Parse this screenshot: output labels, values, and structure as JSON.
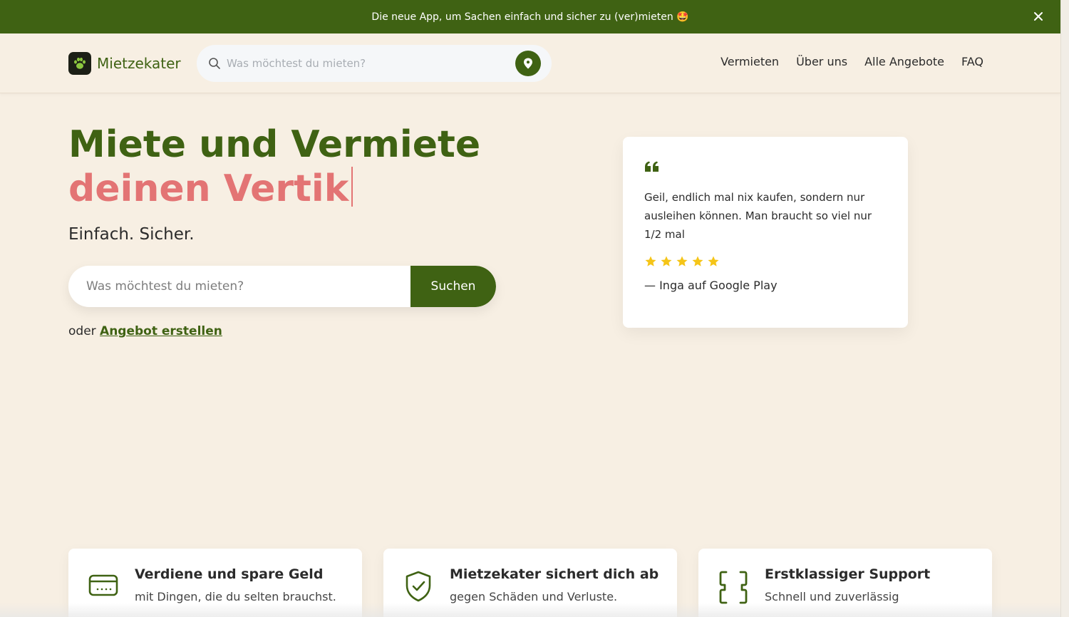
{
  "announcement": {
    "text": "Die neue App, um Sachen einfach und sicher zu (ver)mieten 🤩",
    "close_icon": "close-icon"
  },
  "header": {
    "logo_text": "Mietzekater",
    "logo_icon": "paw-icon",
    "search": {
      "placeholder": "Was möchtest du mieten?",
      "value": "",
      "location_icon": "map-pin-icon"
    },
    "nav": [
      {
        "label": "Vermieten"
      },
      {
        "label": "Über uns"
      },
      {
        "label": "Alle Angebote"
      },
      {
        "label": "FAQ"
      }
    ]
  },
  "hero": {
    "title_line1": "Miete und Vermiete",
    "title_line2": "deinen Vertik",
    "subtitle": "Einfach. Sicher.",
    "search": {
      "placeholder": "Was möchtest du mieten?",
      "value": "",
      "button_label": "Suchen"
    },
    "or_text": "oder",
    "create_link": "Angebot erstellen"
  },
  "testimonial": {
    "quote": "Geil, endlich mal nix kaufen, sondern nur ausleihen können. Man braucht so viel nur 1/2 mal",
    "rating": 5,
    "rating_max": 5,
    "author": "— Inga auf Google Play"
  },
  "features": [
    {
      "icon": "credit-card-icon",
      "title": "Verdiene und spare Geld",
      "description": "mit Dingen, die du selten brauchst."
    },
    {
      "icon": "shield-check-icon",
      "title": "Mietzekater sichert dich ab",
      "description": "gegen Schäden und Verluste."
    },
    {
      "icon": "phone-support-icon",
      "title": "Erstklassiger Support",
      "description": "Schnell und zuverlässig"
    }
  ],
  "colors": {
    "brand_green": "#3f6213",
    "accent_coral": "#e37474",
    "background": "#f7efe3",
    "star_yellow": "#f5c518"
  }
}
